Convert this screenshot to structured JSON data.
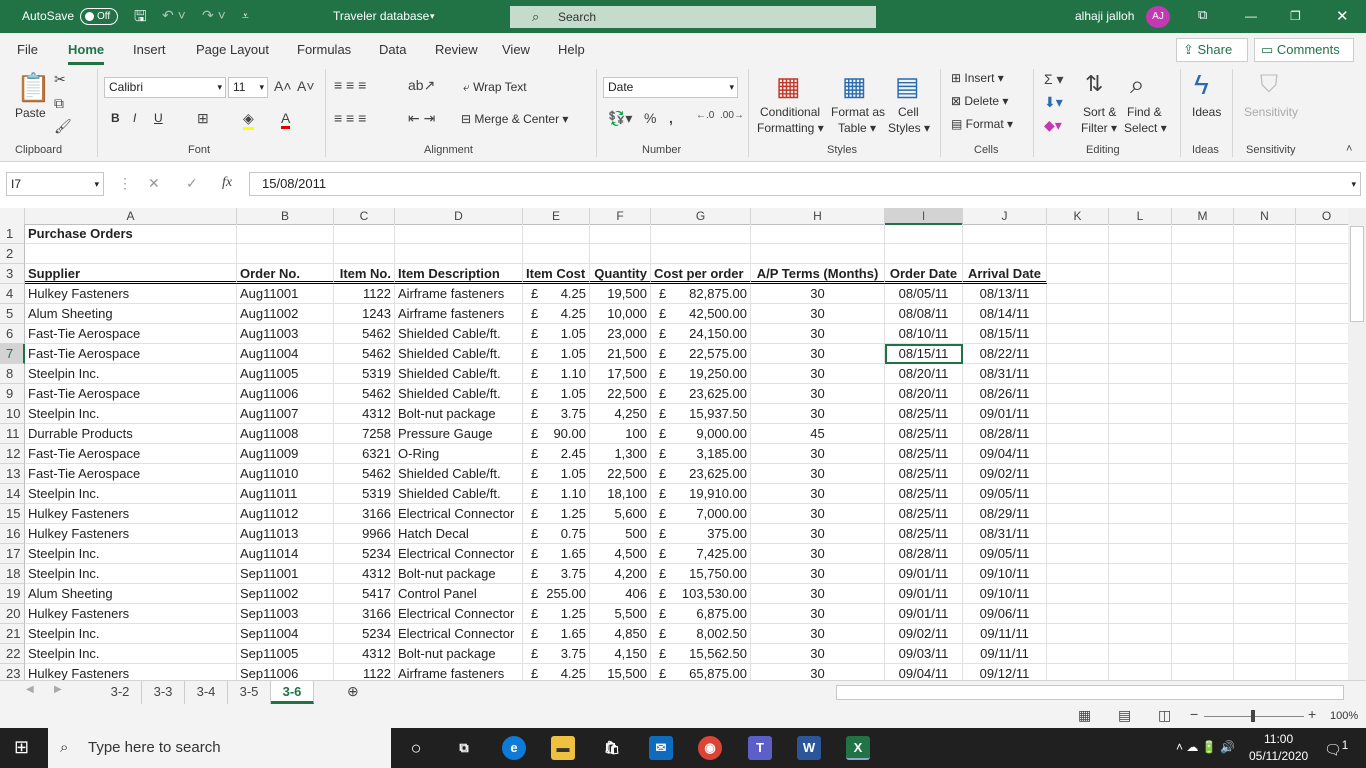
{
  "titlebar": {
    "autosave": "AutoSave",
    "autosave_state": "Off",
    "doc_title": "Traveler database",
    "search": "Search",
    "user": "alhaji jalloh",
    "initials": "AJ"
  },
  "menu": {
    "tabs": [
      "File",
      "Home",
      "Insert",
      "Page Layout",
      "Formulas",
      "Data",
      "Review",
      "View",
      "Help"
    ],
    "active": "Home",
    "share": "Share",
    "comments": "Comments"
  },
  "ribbon": {
    "clipboard": {
      "paste": "Paste",
      "label": "Clipboard"
    },
    "font": {
      "name": "Calibri",
      "size": "11",
      "label": "Font",
      "bold": "B",
      "italic": "I",
      "underline": "U"
    },
    "alignment": {
      "wrap": "Wrap Text",
      "merge": "Merge & Center",
      "label": "Alignment"
    },
    "number": {
      "format": "Date",
      "label": "Number"
    },
    "styles": {
      "conditional": "Conditional",
      "formatting": "Formatting",
      "format_as": "Format as",
      "table": "Table",
      "cell": "Cell",
      "styles": "Styles",
      "label": "Styles"
    },
    "cells": {
      "insert": "Insert",
      "delete": "Delete",
      "format": "Format",
      "label": "Cells"
    },
    "editing": {
      "sort": "Sort &",
      "filter": "Filter",
      "find": "Find &",
      "select": "Select",
      "label": "Editing"
    },
    "ideas": {
      "btn": "Ideas",
      "label": "Ideas"
    },
    "sensitivity": {
      "btn": "Sensitivity",
      "label": "Sensitivity"
    }
  },
  "formula_bar": {
    "name_box": "I7",
    "fx": "fx",
    "value": "15/08/2011"
  },
  "sheet": {
    "columns": [
      "A",
      "B",
      "C",
      "D",
      "E",
      "F",
      "G",
      "H",
      "I",
      "J",
      "K",
      "L",
      "M",
      "N",
      "O"
    ],
    "title": "Purchase Orders",
    "headers": [
      "Supplier",
      "Order No.",
      "Item No.",
      "Item Description",
      "Item Cost",
      "Quantity",
      "Cost per order",
      "A/P Terms (Months)",
      "Order Date",
      "Arrival Date"
    ],
    "currency_symbol": "£",
    "selected_cell": "I7",
    "rows": [
      [
        "Hulkey Fasteners",
        "Aug11001",
        "1122",
        "Airframe fasteners",
        "4.25",
        "19,500",
        "82,875.00",
        "30",
        "08/05/11",
        "08/13/11"
      ],
      [
        "Alum Sheeting",
        "Aug11002",
        "1243",
        "Airframe fasteners",
        "4.25",
        "10,000",
        "42,500.00",
        "30",
        "08/08/11",
        "08/14/11"
      ],
      [
        "Fast-Tie Aerospace",
        "Aug11003",
        "5462",
        "Shielded Cable/ft.",
        "1.05",
        "23,000",
        "24,150.00",
        "30",
        "08/10/11",
        "08/15/11"
      ],
      [
        "Fast-Tie Aerospace",
        "Aug11004",
        "5462",
        "Shielded Cable/ft.",
        "1.05",
        "21,500",
        "22,575.00",
        "30",
        "08/15/11",
        "08/22/11"
      ],
      [
        "Steelpin Inc.",
        "Aug11005",
        "5319",
        "Shielded Cable/ft.",
        "1.10",
        "17,500",
        "19,250.00",
        "30",
        "08/20/11",
        "08/31/11"
      ],
      [
        "Fast-Tie Aerospace",
        "Aug11006",
        "5462",
        "Shielded Cable/ft.",
        "1.05",
        "22,500",
        "23,625.00",
        "30",
        "08/20/11",
        "08/26/11"
      ],
      [
        "Steelpin Inc.",
        "Aug11007",
        "4312",
        "Bolt-nut package",
        "3.75",
        "4,250",
        "15,937.50",
        "30",
        "08/25/11",
        "09/01/11"
      ],
      [
        "Durrable Products",
        "Aug11008",
        "7258",
        "Pressure Gauge",
        "90.00",
        "100",
        "9,000.00",
        "45",
        "08/25/11",
        "08/28/11"
      ],
      [
        "Fast-Tie Aerospace",
        "Aug11009",
        "6321",
        "O-Ring",
        "2.45",
        "1,300",
        "3,185.00",
        "30",
        "08/25/11",
        "09/04/11"
      ],
      [
        "Fast-Tie Aerospace",
        "Aug11010",
        "5462",
        "Shielded Cable/ft.",
        "1.05",
        "22,500",
        "23,625.00",
        "30",
        "08/25/11",
        "09/02/11"
      ],
      [
        "Steelpin Inc.",
        "Aug11011",
        "5319",
        "Shielded Cable/ft.",
        "1.10",
        "18,100",
        "19,910.00",
        "30",
        "08/25/11",
        "09/05/11"
      ],
      [
        "Hulkey Fasteners",
        "Aug11012",
        "3166",
        "Electrical Connector",
        "1.25",
        "5,600",
        "7,000.00",
        "30",
        "08/25/11",
        "08/29/11"
      ],
      [
        "Hulkey Fasteners",
        "Aug11013",
        "9966",
        "Hatch Decal",
        "0.75",
        "500",
        "375.00",
        "30",
        "08/25/11",
        "08/31/11"
      ],
      [
        "Steelpin Inc.",
        "Aug11014",
        "5234",
        "Electrical Connector",
        "1.65",
        "4,500",
        "7,425.00",
        "30",
        "08/28/11",
        "09/05/11"
      ],
      [
        "Steelpin Inc.",
        "Sep11001",
        "4312",
        "Bolt-nut package",
        "3.75",
        "4,200",
        "15,750.00",
        "30",
        "09/01/11",
        "09/10/11"
      ],
      [
        "Alum Sheeting",
        "Sep11002",
        "5417",
        "Control Panel",
        "255.00",
        "406",
        "103,530.00",
        "30",
        "09/01/11",
        "09/10/11"
      ],
      [
        "Hulkey Fasteners",
        "Sep11003",
        "3166",
        "Electrical Connector",
        "1.25",
        "5,500",
        "6,875.00",
        "30",
        "09/01/11",
        "09/06/11"
      ],
      [
        "Steelpin Inc.",
        "Sep11004",
        "5234",
        "Electrical Connector",
        "1.65",
        "4,850",
        "8,002.50",
        "30",
        "09/02/11",
        "09/11/11"
      ],
      [
        "Steelpin Inc.",
        "Sep11005",
        "4312",
        "Bolt-nut package",
        "3.75",
        "4,150",
        "15,562.50",
        "30",
        "09/03/11",
        "09/11/11"
      ],
      [
        "Hulkey Fasteners",
        "Sep11006",
        "1122",
        "Airframe fasteners",
        "4.25",
        "15,500",
        "65,875.00",
        "30",
        "09/04/11",
        "09/12/11"
      ]
    ]
  },
  "sheet_tabs": {
    "tabs": [
      "3-2",
      "3-3",
      "3-4",
      "3-5",
      "3-6"
    ],
    "active": "3-6"
  },
  "status": {
    "zoom": "100%"
  },
  "taskbar": {
    "search": "Type here to search",
    "time": "11:00",
    "date": "05/11/2020",
    "notifications": "1"
  },
  "colors": {
    "accent": "#217346",
    "selection": "#217346"
  }
}
